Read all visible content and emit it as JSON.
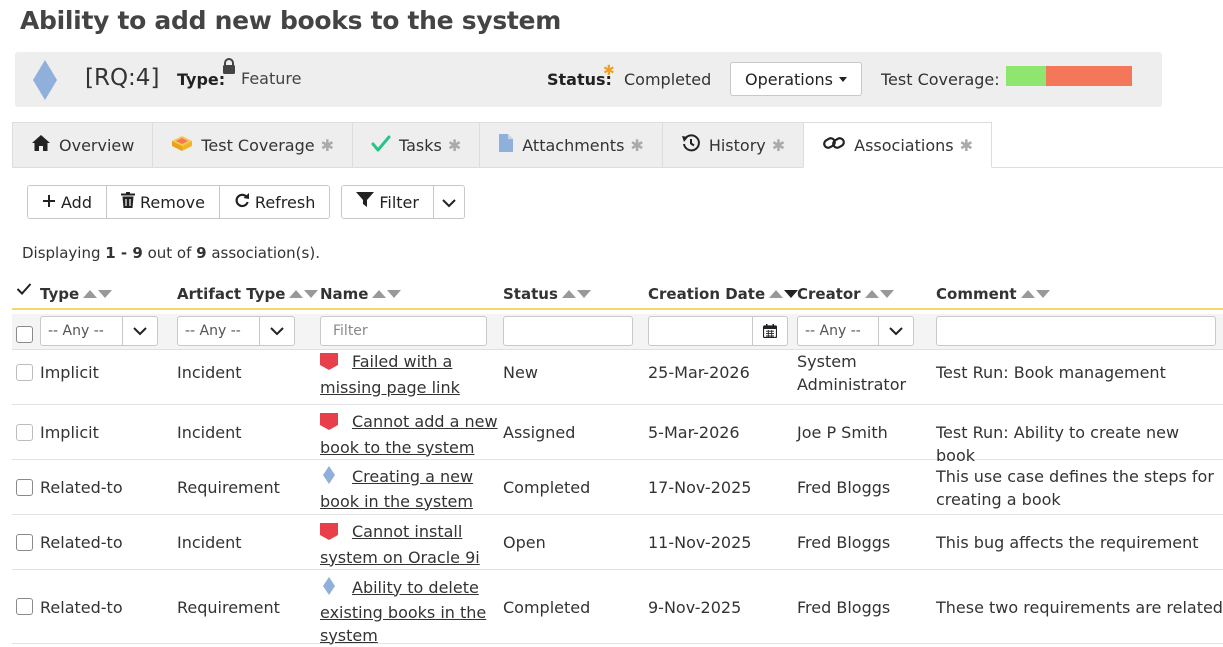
{
  "page": {
    "title": "Ability to add new books to the system"
  },
  "header": {
    "token": "[RQ:4]",
    "type_label": "Type:",
    "type_value": "Feature",
    "status_label": "Status:",
    "status_value": "Completed",
    "operations_label": "Operations",
    "coverage_label": "Test Coverage:",
    "coverage": {
      "passed_fraction": 0.32,
      "failed_fraction": 0.68,
      "pass_color": "#8ee66e",
      "fail_color": "#f4775a"
    },
    "requirement_color": "#8fb0db",
    "required_color": "#f0a020"
  },
  "tabs": [
    {
      "label": "Overview",
      "icon": "home-icon",
      "asterisk": ""
    },
    {
      "label": "Test Coverage",
      "icon": "test-coverage-icon",
      "asterisk": "✱"
    },
    {
      "label": "Tasks",
      "icon": "check-icon",
      "asterisk": "✱"
    },
    {
      "label": "Attachments",
      "icon": "document-icon",
      "asterisk": "✱"
    },
    {
      "label": "History",
      "icon": "history-icon",
      "asterisk": "✱"
    },
    {
      "label": "Associations",
      "icon": "link-icon",
      "asterisk": "✱",
      "active": true
    }
  ],
  "toolbar": {
    "add": "Add",
    "remove": "Remove",
    "refresh": "Refresh",
    "filter": "Filter"
  },
  "display": {
    "prefix": "Displaying ",
    "range": "1 - 9",
    "mid": " out of ",
    "total": "9",
    "suffix": " association(s)."
  },
  "columns": {
    "type": "Type",
    "artifact_type": "Artifact Type",
    "name": "Name",
    "status": "Status",
    "creation_date": "Creation Date",
    "creator": "Creator",
    "comment": "Comment"
  },
  "filters": {
    "any": "-- Any --",
    "name_placeholder": "Filter"
  },
  "incident_color": "#e8404a",
  "rows": [
    {
      "type": "Implicit",
      "artifact_type": "Incident",
      "icon": "incident-flag-icon",
      "name_line1": "Failed with a",
      "name_line2": "missing page link",
      "status": "New",
      "date": "25-Mar-2026",
      "creator_line1": "System",
      "creator_line2": "Administrator",
      "comment_line1": "Test Run: Book management",
      "comment_line2": ""
    },
    {
      "type": "Implicit",
      "artifact_type": "Incident",
      "icon": "incident-flag-icon",
      "name_line1": "Cannot add a new",
      "name_line2": "book to the system",
      "status": "Assigned",
      "date": "5-Mar-2026",
      "creator_line1": "Joe P Smith",
      "creator_line2": "",
      "comment_line1": "Test Run: Ability to create new book",
      "comment_line2": ""
    },
    {
      "type": "Related-to",
      "artifact_type": "Requirement",
      "icon": "requirement-diamond-icon",
      "name_line1": "Creating a new",
      "name_line2": "book in the system",
      "status": "Completed",
      "date": "17-Nov-2025",
      "creator_line1": "Fred Bloggs",
      "creator_line2": "",
      "comment_line1": "This use case defines the steps for",
      "comment_line2": "creating a book"
    },
    {
      "type": "Related-to",
      "artifact_type": "Incident",
      "icon": "incident-flag-icon",
      "name_line1": "Cannot install",
      "name_line2": "system on Oracle 9i",
      "status": "Open",
      "date": "11-Nov-2025",
      "creator_line1": "Fred Bloggs",
      "creator_line2": "",
      "comment_line1": "This bug affects the requirement",
      "comment_line2": ""
    },
    {
      "type": "Related-to",
      "artifact_type": "Requirement",
      "icon": "requirement-diamond-icon",
      "name_line1": "Ability to delete",
      "name_line2": "existing books in the",
      "name_line3": "system",
      "status": "Completed",
      "date": "9-Nov-2025",
      "creator_line1": "Fred Bloggs",
      "creator_line2": "",
      "comment_line1": "These two requirements are related",
      "comment_line2": ""
    }
  ]
}
